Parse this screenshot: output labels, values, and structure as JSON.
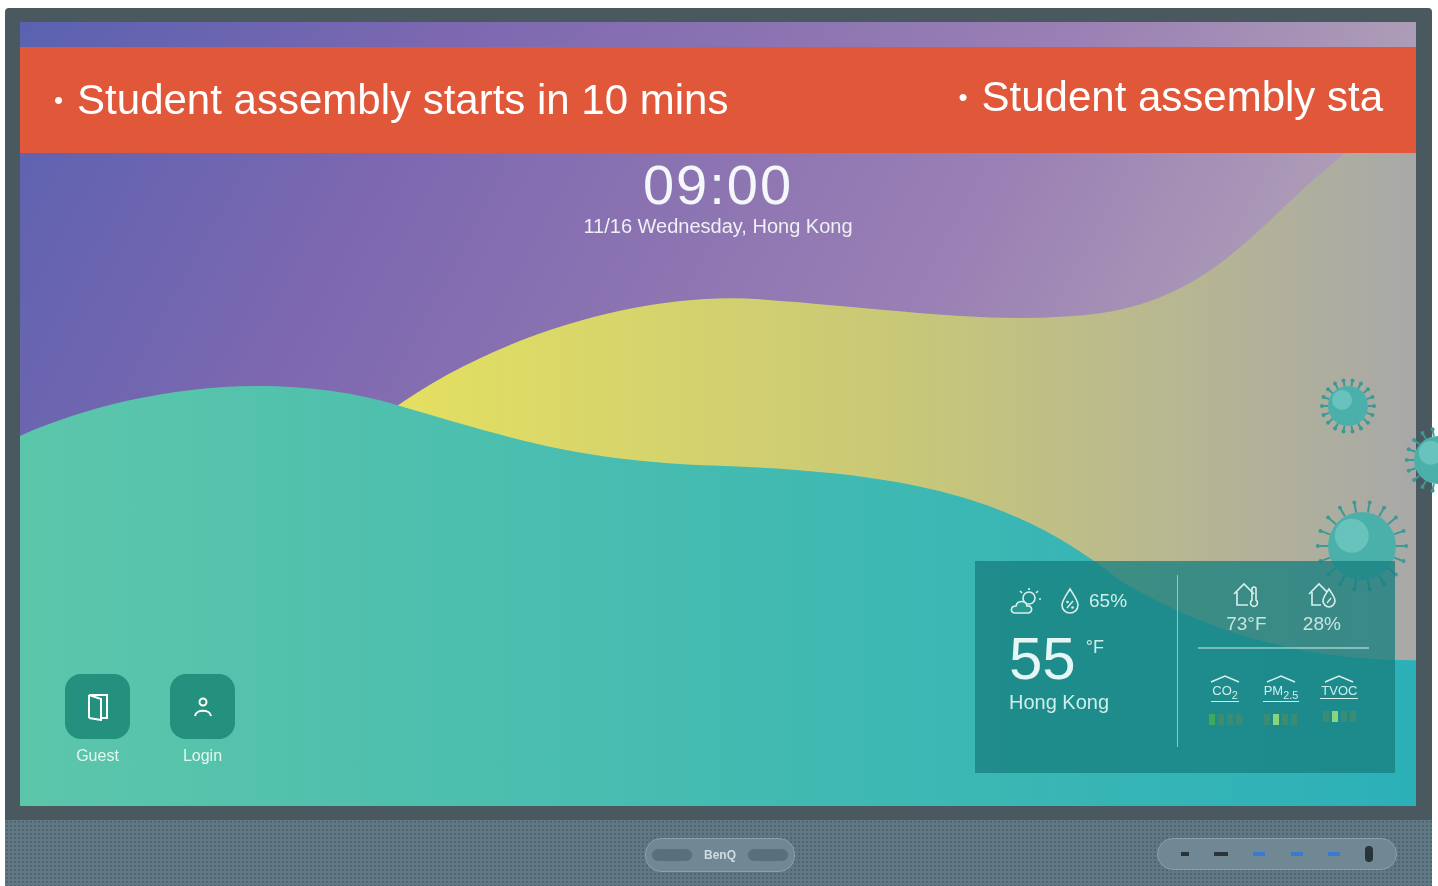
{
  "banner": {
    "messages": [
      {
        "bullet": "•",
        "text": "Student assembly starts in 10 mins"
      },
      {
        "bullet": "•",
        "text": "Student assembly sta"
      }
    ]
  },
  "clock": {
    "time": "09:00",
    "date": "11/16 Wednesday, Hong Kong"
  },
  "shortcuts": [
    {
      "kind": "guest",
      "label": "Guest"
    },
    {
      "kind": "login",
      "label": "Login"
    }
  ],
  "weather": {
    "humidity": "65%",
    "temperature": "55",
    "unit": "°F",
    "city": "Hong Kong"
  },
  "indoor": [
    {
      "kind": "temperature",
      "value": "73°F"
    },
    {
      "kind": "humidity",
      "value": "28%"
    }
  ],
  "air_quality": [
    {
      "label": "CO$_{2}$",
      "color": "#3aaa5c",
      "segments": [
        {
          "on": true
        },
        {
          "on": false
        },
        {
          "on": false
        },
        {
          "on": false
        }
      ]
    },
    {
      "label": "PM$_{2.5}$",
      "color": "#8cd47c",
      "segments": [
        {
          "on": false
        },
        {
          "on": true
        },
        {
          "on": false
        },
        {
          "on": false
        }
      ]
    },
    {
      "label": "TVOC",
      "color": "#8cd47c",
      "segments": [
        {
          "on": false
        },
        {
          "on": true
        },
        {
          "on": false
        },
        {
          "on": false
        }
      ]
    }
  ],
  "bezel": {
    "logo": "BenQ"
  }
}
